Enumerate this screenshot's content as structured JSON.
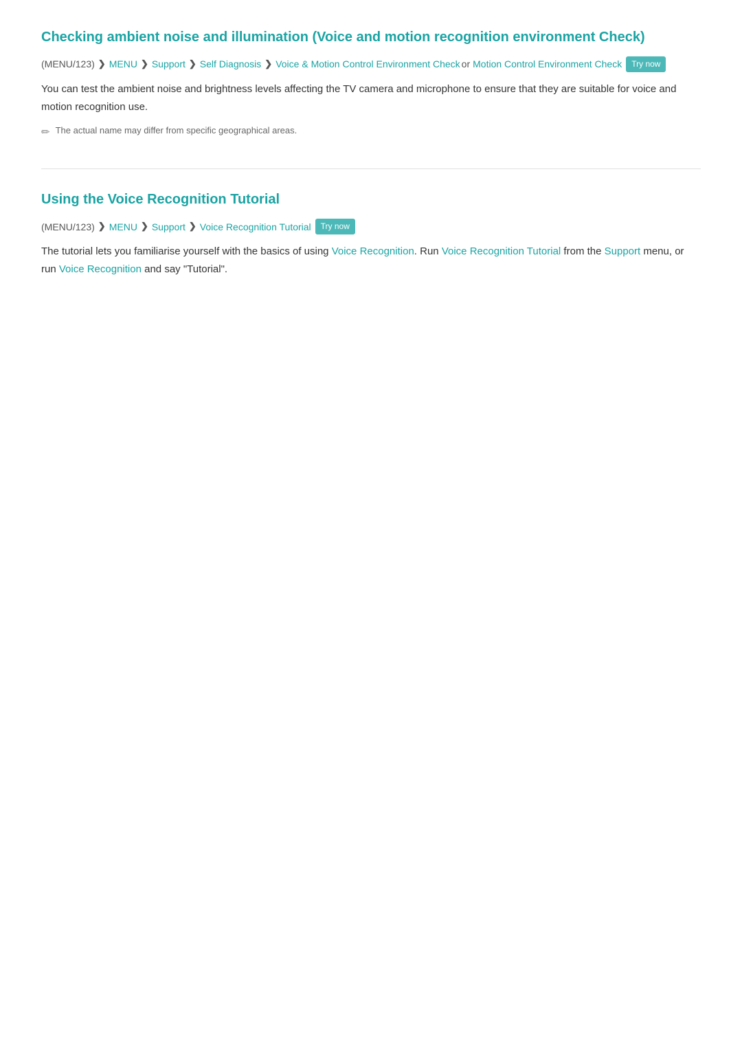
{
  "section1": {
    "title": "Checking ambient noise and illumination (Voice and motion recognition environment Check)",
    "breadcrumb": {
      "menu123": "(MENU/123)",
      "chevron1": "❯",
      "menu": "MENU",
      "chevron2": "❯",
      "support": "Support",
      "chevron3": "❯",
      "selfDiagnosis": "Self Diagnosis",
      "chevron4": "❯",
      "voiceMotion": "Voice & Motion Control Environment Check",
      "or": "or",
      "motionControl": "Motion Control Environment Check",
      "tryNow": "Try now"
    },
    "body": "You can test the ambient noise and brightness levels affecting the TV camera and microphone to ensure that they are suitable for voice and motion recognition use.",
    "note": "The actual name may differ from specific geographical areas."
  },
  "section2": {
    "title": "Using the Voice Recognition Tutorial",
    "breadcrumb": {
      "menu123": "(MENU/123)",
      "chevron1": "❯",
      "menu": "MENU",
      "chevron2": "❯",
      "support": "Support",
      "chevron3": "❯",
      "voiceTutorial": "Voice Recognition Tutorial",
      "tryNow": "Try now"
    },
    "body1": "The tutorial lets you familiarise yourself with the basics of using ",
    "voiceRecognition1": "Voice Recognition",
    "body2": ". Run ",
    "voiceRecognitionTutorial": "Voice Recognition Tutorial",
    "body3": " from the ",
    "support": "Support",
    "body4": " menu, or run ",
    "voiceRecognition2": "Voice Recognition",
    "body5": " and say \"Tutorial\"."
  }
}
